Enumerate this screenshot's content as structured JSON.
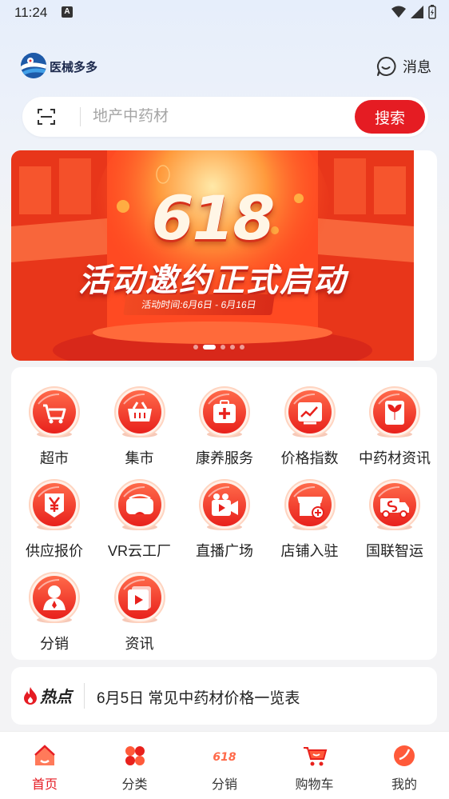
{
  "status_bar": {
    "time": "11:24",
    "notification": "A"
  },
  "header": {
    "app_name": "医械多多",
    "message_label": "消息"
  },
  "search": {
    "placeholder": "地产中药材",
    "button_label": "搜索"
  },
  "banner": {
    "headline_number": "618",
    "headline": "活动邀约正式启动",
    "date_text": "活动时间:6月6日 - 6月16日",
    "slide_count": 5,
    "active_slide": 2
  },
  "features": [
    {
      "label": "超市",
      "icon": "shopping-cart-icon"
    },
    {
      "label": "集市",
      "icon": "basket-icon"
    },
    {
      "label": "康养服务",
      "icon": "medical-kit-icon"
    },
    {
      "label": "价格指数",
      "icon": "price-chart-icon"
    },
    {
      "label": "中药材资讯",
      "icon": "herb-leaf-icon"
    },
    {
      "label": "供应报价",
      "icon": "yen-tag-icon"
    },
    {
      "label": "VR云工厂",
      "icon": "vr-headset-icon"
    },
    {
      "label": "直播广场",
      "icon": "video-camera-icon"
    },
    {
      "label": "店铺入驻",
      "icon": "storefront-icon"
    },
    {
      "label": "国联智运",
      "icon": "delivery-truck-icon"
    },
    {
      "label": "分销",
      "icon": "person-icon"
    },
    {
      "label": "资讯",
      "icon": "play-news-icon"
    }
  ],
  "hot_news": {
    "badge": "热点",
    "title": "6月5日 常见中药材价格一览表"
  },
  "nav": [
    {
      "label": "首页",
      "icon": "home-icon",
      "active": true
    },
    {
      "label": "分类",
      "icon": "category-icon",
      "active": false
    },
    {
      "label": "分销",
      "icon": "618-icon",
      "active": false
    },
    {
      "label": "购物车",
      "icon": "cart-icon",
      "active": false
    },
    {
      "label": "我的",
      "icon": "profile-icon",
      "active": false
    }
  ],
  "colors": {
    "accent": "#e51c23",
    "icon_gradient_top": "#ff6a4a",
    "icon_gradient_bottom": "#e8211c"
  }
}
